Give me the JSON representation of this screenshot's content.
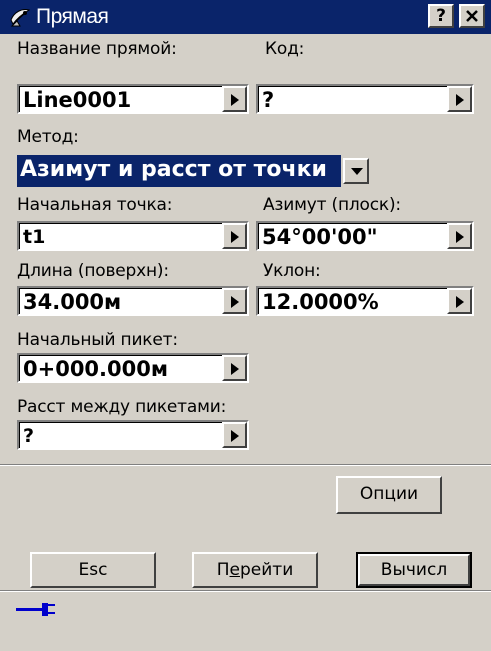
{
  "window": {
    "title": "Прямая",
    "help_label": "?",
    "close_label": "✕"
  },
  "form": {
    "name": {
      "label": "Название прямой:",
      "value": "Line0001"
    },
    "code": {
      "label": "Код:",
      "value": "?"
    },
    "method": {
      "label": "Метод:",
      "value": "Азимут и расст от точки"
    },
    "start_point": {
      "label": "Начальная точка:",
      "value": "t1"
    },
    "azimuth": {
      "label": "Азимут (плоск):",
      "value": "54°00'00\""
    },
    "length": {
      "label": "Длина (поверхн):",
      "value": "34.000м"
    },
    "slope": {
      "label": "Уклон:",
      "value": "12.0000%"
    },
    "start_station": {
      "label": "Начальный пикет:",
      "value": "0+000.000м"
    },
    "station_interval": {
      "label": "Расст между пикетами:",
      "value": "?"
    }
  },
  "buttons": {
    "options": "Опции",
    "esc": "Esc",
    "goto_prefix": "П",
    "goto_underlined": "е",
    "goto_suffix": "рейти",
    "calc": "Вычисл"
  },
  "icons": {
    "window": "satellite-dish-icon",
    "connection": "plug-icon"
  },
  "colors": {
    "titlebar": "#0a246a",
    "window_bg": "#d4d0c8",
    "selection": "#0a246a",
    "plug": "#0000cc"
  }
}
